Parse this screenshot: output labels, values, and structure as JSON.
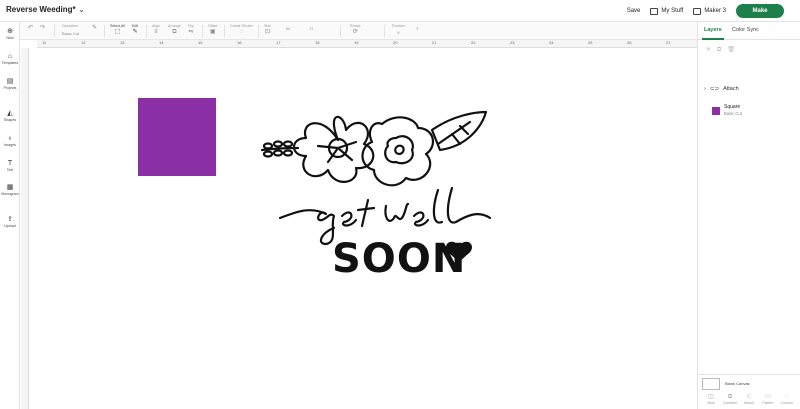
{
  "header": {
    "doc_title": "Reverse Weeding*",
    "save_label": "Save",
    "my_stuff_label": "My Stuff",
    "machine_label": "Maker 3",
    "make_label": "Make"
  },
  "toolbar": {
    "operation_label": "Operation",
    "operation_value": "Basic Cut",
    "select_all_label": "Select All",
    "edit_label": "Edit",
    "align_label": "Align",
    "arrange_label": "Arrange",
    "flip_label": "Flip",
    "offset_label": "Offset",
    "create_sticker_label": "Create Sticker",
    "size_label": "Size",
    "rotate_label": "Rotate",
    "position_label": "Position"
  },
  "sidebar": {
    "items": [
      {
        "label": "New",
        "icon": "plus-circle-icon"
      },
      {
        "label": "Templates",
        "icon": "shirt-icon"
      },
      {
        "label": "Projects",
        "icon": "projects-icon"
      },
      {
        "label": "Shapes",
        "icon": "shapes-icon"
      },
      {
        "label": "Images",
        "icon": "lightbulb-icon"
      },
      {
        "label": "Text",
        "icon": "text-icon"
      },
      {
        "label": "Monogram",
        "icon": "monogram-icon"
      },
      {
        "label": "Upload",
        "icon": "upload-icon"
      }
    ]
  },
  "ruler": {
    "top": [
      "11",
      "12",
      "13",
      "14",
      "15",
      "16",
      "17",
      "18",
      "19",
      "20",
      "21",
      "22",
      "23",
      "24",
      "25",
      "26",
      "27"
    ]
  },
  "canvas": {
    "artwork_text_script": "get well",
    "artwork_text_bold": "SOON",
    "square_color": "#8b2fa6"
  },
  "panel": {
    "tabs": [
      "Layers",
      "Color Sync"
    ],
    "attach_label": "Attach",
    "layer_name": "Square",
    "layer_sub": "Basic Cut",
    "blank_canvas_label": "Blank Canvas",
    "actions": [
      "Slice",
      "Combine",
      "Attach",
      "Flatten",
      "Contour"
    ]
  },
  "colors": {
    "accent": "#1d7f4a",
    "square": "#8b2fa6"
  }
}
